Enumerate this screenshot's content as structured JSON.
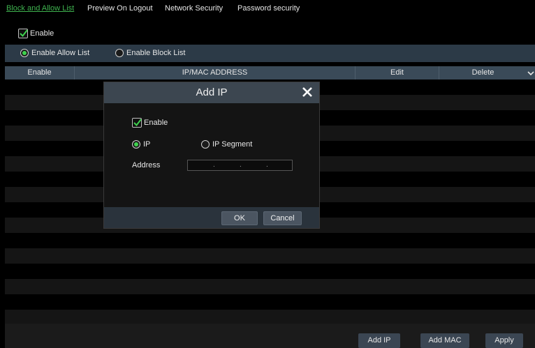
{
  "tabs": [
    {
      "label": "Block and Allow List",
      "active": true
    },
    {
      "label": "Preview On Logout",
      "active": false
    },
    {
      "label": "Network Security",
      "active": false
    },
    {
      "label": "Password security",
      "active": false
    }
  ],
  "enable": {
    "label": "Enable",
    "checked": true
  },
  "list_mode": {
    "options": [
      {
        "label": "Enable Allow List",
        "selected": true
      },
      {
        "label": "Enable Block List",
        "selected": false
      }
    ]
  },
  "table": {
    "columns": [
      "Enable",
      "IP/MAC ADDRESS",
      "Edit",
      "Delete"
    ],
    "rows": []
  },
  "footer": {
    "add_ip_label": "Add IP",
    "add_mac_label": "Add MAC",
    "apply_label": "Apply"
  },
  "dialog": {
    "title": "Add IP",
    "enable_label": "Enable",
    "enable_checked": true,
    "type_options": [
      {
        "label": "IP",
        "selected": true
      },
      {
        "label": "IP Segment",
        "selected": false
      }
    ],
    "address_label": "Address",
    "address_value": "",
    "ok_label": "OK",
    "cancel_label": "Cancel"
  },
  "colors": {
    "accent_green": "#3fb34f",
    "header_bar": "#2c3a47",
    "button": "#3b4653"
  },
  "icons": {
    "close": "close-icon",
    "check": "checkmark-icon",
    "scroll": "chevron-down-icon"
  }
}
